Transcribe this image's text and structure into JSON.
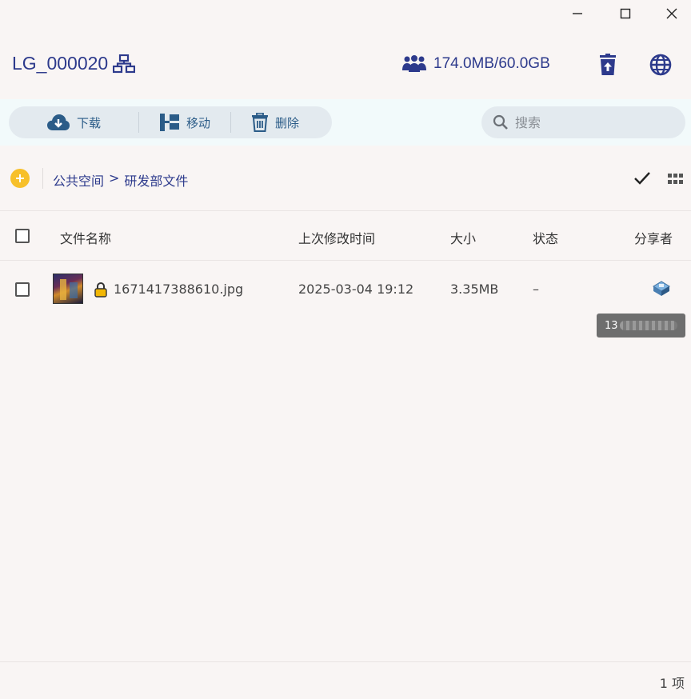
{
  "window": {
    "controls": [
      "minimize",
      "maximize",
      "close"
    ]
  },
  "header": {
    "title": "LG_000020",
    "storage_text": "174.0MB/60.0GB",
    "icons": [
      "network-icon",
      "users-icon",
      "recycle-upload-icon",
      "globe-icon"
    ]
  },
  "toolbar": {
    "download_label": "下载",
    "move_label": "移动",
    "delete_label": "删除",
    "search_placeholder": "搜索"
  },
  "breadcrumb": {
    "items": [
      "公共空间",
      "研发部文件"
    ],
    "separator": ">"
  },
  "table": {
    "columns": [
      "文件名称",
      "上次修改时间",
      "大小",
      "状态",
      "分享者"
    ],
    "rows": [
      {
        "name": "1671417388610.jpg",
        "modified": "2025-03-04 19:12",
        "size": "3.35MB",
        "status": "–",
        "locked": true
      }
    ]
  },
  "tooltip": {
    "prefix": "13"
  },
  "footer": {
    "count": "1 项"
  },
  "colors": {
    "accent": "#2d3a8c",
    "toolbar_text": "#2b5c88",
    "add_button": "#f7c02a",
    "lock": "#f2b705"
  }
}
